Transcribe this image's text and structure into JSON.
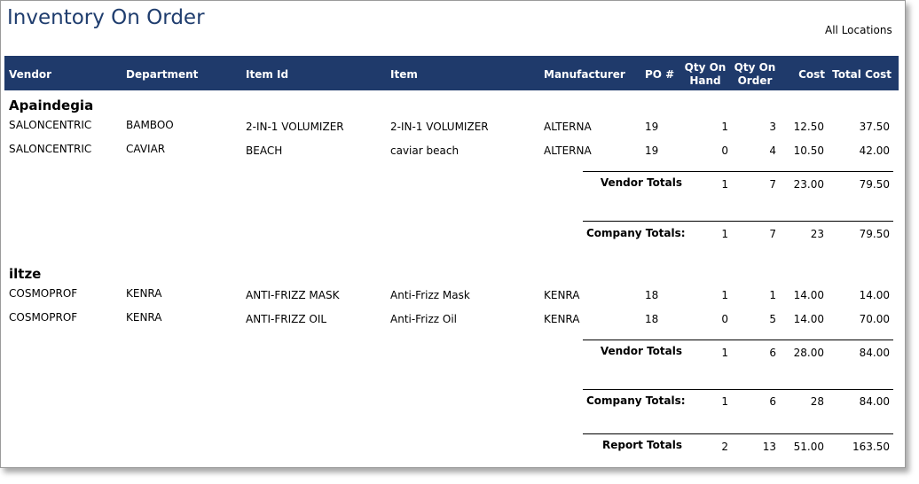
{
  "report": {
    "title": "Inventory On Order",
    "location_filter": "All Locations"
  },
  "columns": {
    "vendor": "Vendor",
    "department": "Department",
    "item_id": "Item Id",
    "item": "Item",
    "manufacturer": "Manufacturer",
    "po": "PO #",
    "qty_on_hand": [
      "Qty On",
      "Hand"
    ],
    "qty_on_order": [
      "Qty On",
      "Order"
    ],
    "cost": "Cost",
    "total_cost": "Total Cost"
  },
  "groups": [
    {
      "name": "Apaindegia",
      "rows": [
        {
          "vendor": "SALONCENTRIC",
          "department": "BAMBOO",
          "item_id": "2-IN-1 VOLUMIZER",
          "item": "2-IN-1 VOLUMIZER",
          "manufacturer": "ALTERNA",
          "po": "19",
          "qty_on_hand": "1",
          "qty_on_order": "3",
          "cost": "12.50",
          "total_cost": "37.50"
        },
        {
          "vendor": "SALONCENTRIC",
          "department": "CAVIAR",
          "item_id": "BEACH",
          "item": "caviar beach",
          "manufacturer": "ALTERNA",
          "po": "19",
          "qty_on_hand": "0",
          "qty_on_order": "4",
          "cost": "10.50",
          "total_cost": "42.00"
        }
      ],
      "vendor_totals": {
        "label": "Vendor Totals",
        "qty_on_hand": "1",
        "qty_on_order": "7",
        "cost": "23.00",
        "total_cost": "79.50"
      },
      "company_totals": {
        "label": "Company Totals:",
        "qty_on_hand": "1",
        "qty_on_order": "7",
        "cost": "23",
        "total_cost": "79.50"
      }
    },
    {
      "name": "iltze",
      "rows": [
        {
          "vendor": "COSMOPROF",
          "department": "KENRA",
          "item_id": "ANTI-FRIZZ MASK",
          "item": "Anti-Frizz Mask",
          "manufacturer": "KENRA",
          "po": "18",
          "qty_on_hand": "1",
          "qty_on_order": "1",
          "cost": "14.00",
          "total_cost": "14.00"
        },
        {
          "vendor": "COSMOPROF",
          "department": "KENRA",
          "item_id": "ANTI-FRIZZ OIL",
          "item": "Anti-Frizz Oil",
          "manufacturer": "KENRA",
          "po": "18",
          "qty_on_hand": "0",
          "qty_on_order": "5",
          "cost": "14.00",
          "total_cost": "70.00"
        }
      ],
      "vendor_totals": {
        "label": "Vendor Totals",
        "qty_on_hand": "1",
        "qty_on_order": "6",
        "cost": "28.00",
        "total_cost": "84.00"
      },
      "company_totals": {
        "label": "Company Totals:",
        "qty_on_hand": "1",
        "qty_on_order": "6",
        "cost": "28",
        "total_cost": "84.00"
      }
    }
  ],
  "report_totals": {
    "label": "Report Totals",
    "qty_on_hand": "2",
    "qty_on_order": "13",
    "cost": "51.00",
    "total_cost": "163.50"
  }
}
